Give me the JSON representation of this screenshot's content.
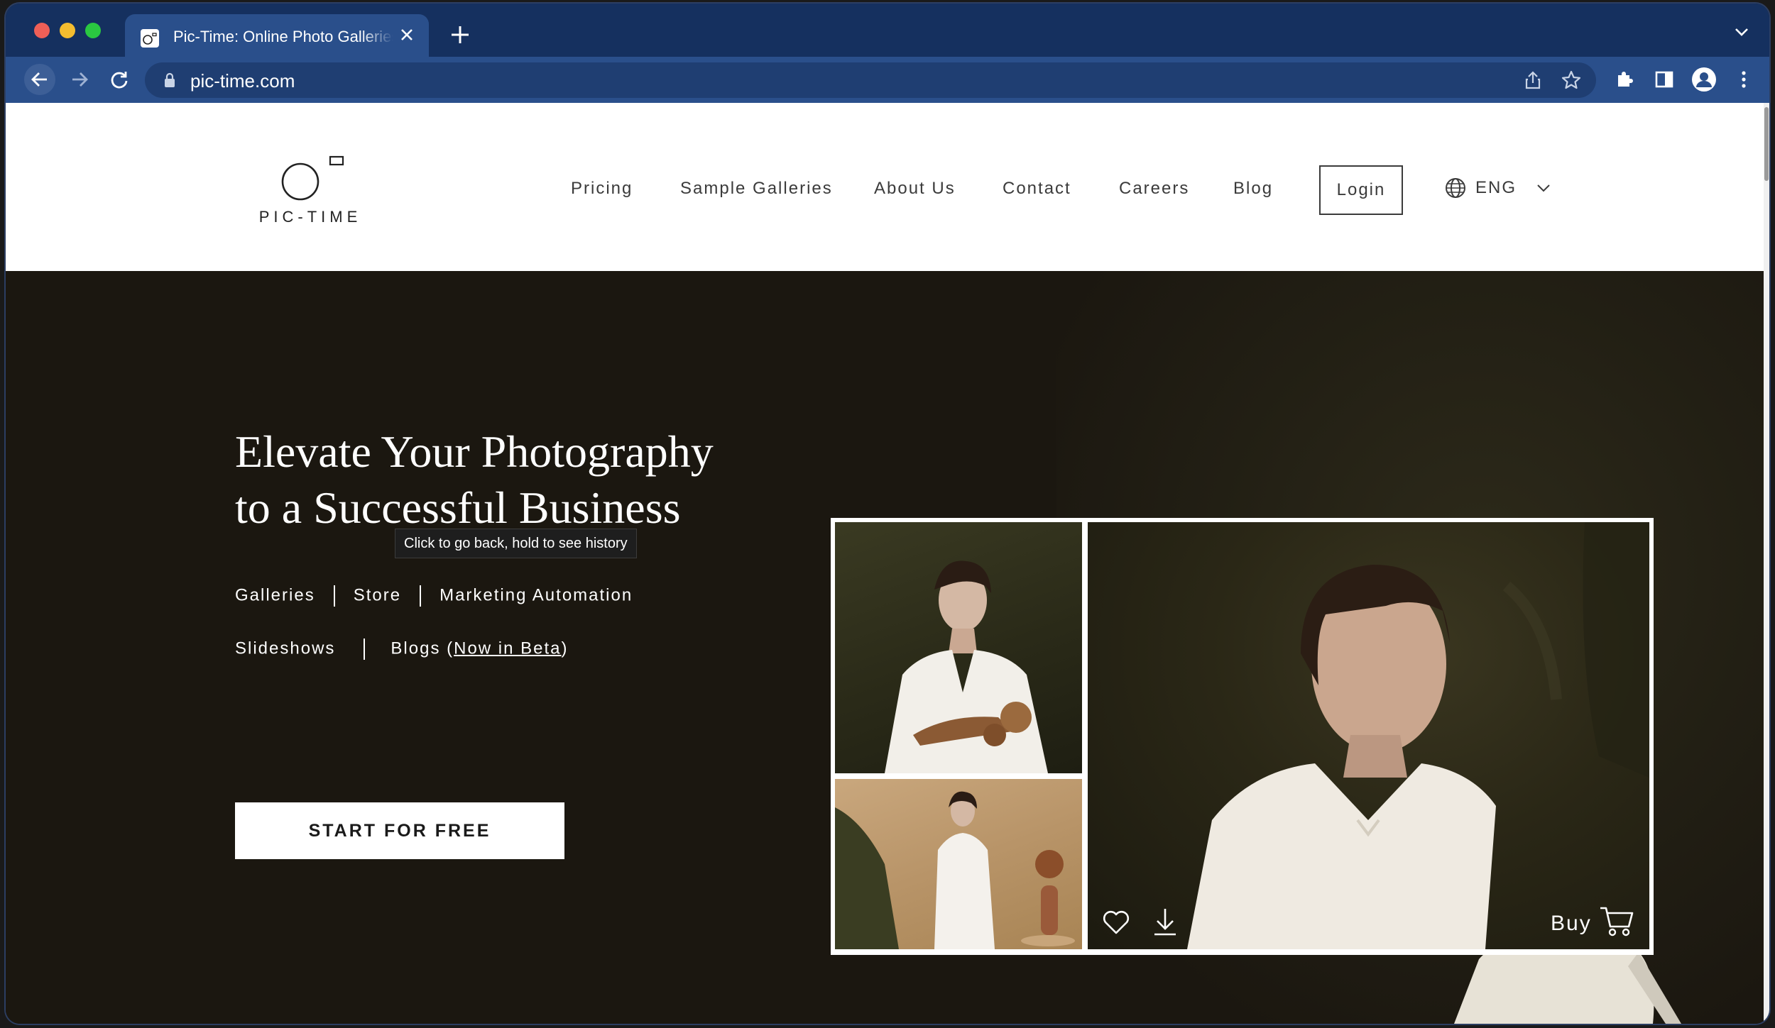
{
  "browser": {
    "tab_title": "Pic-Time: Online Photo Galleries",
    "url": "pic-time.com",
    "new_tab_label": "+",
    "tooltip": "Click to go back, hold to see history"
  },
  "site": {
    "logo_text": "PIC-TIME",
    "nav": [
      "Pricing",
      "Sample Galleries",
      "About Us",
      "Contact",
      "Careers",
      "Blog"
    ],
    "login_label": "Login",
    "language": "ENG"
  },
  "hero": {
    "headline_line1": "Elevate Your Photography",
    "headline_line2": "to a Successful Business",
    "features_row1": [
      "Galleries",
      "Store",
      "Marketing Automation"
    ],
    "features_row2_a": "Slideshows",
    "features_row2_b_prefix": "Blogs (",
    "features_row2_b_link": "Now in Beta",
    "features_row2_b_suffix": ")",
    "cta_label": "START FOR FREE",
    "buy_label": "Buy"
  },
  "colors": {
    "tab_strip": "#15305f",
    "toolbar": "#2a4f8b",
    "hero_bg": "#1b1710",
    "header_bg": "#ffffff"
  },
  "icons": [
    "back-arrow-icon",
    "forward-arrow-icon",
    "reload-icon",
    "lock-icon",
    "share-icon",
    "star-icon",
    "extensions-icon",
    "side-panel-icon",
    "profile-icon",
    "more-menu-icon",
    "globe-icon",
    "chevron-down-icon",
    "heart-icon",
    "download-icon",
    "cart-icon"
  ]
}
